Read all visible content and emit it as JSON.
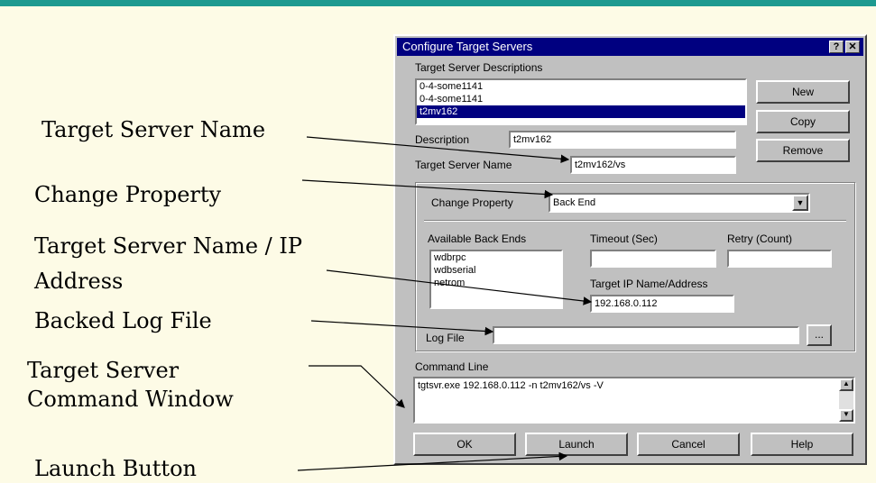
{
  "callouts": {
    "target_server_name": "Target Server Name",
    "change_property": "Change Property",
    "target_ip_line1": "Target Server Name / IP",
    "target_ip_line2": "Address",
    "backed_log_file": "Backed Log File",
    "command_window_line1": "Target Server",
    "command_window_line2": "Command Window",
    "launch_button": "Launch Button"
  },
  "dialog": {
    "title": "Configure Target Servers",
    "help_glyph": "?",
    "close_glyph": "✕",
    "descriptions_label": "Target Server Descriptions",
    "descriptions": [
      "0-4-some1141",
      "0-4-some1141",
      "t2mv162"
    ],
    "selected_index": 2,
    "new_label": "New",
    "copy_label": "Copy",
    "remove_label": "Remove",
    "description_label": "Description",
    "description_value": "t2mv162",
    "target_server_name_label": "Target Server Name",
    "target_server_name_value": "t2mv162/vs",
    "change_property_label": "Change Property",
    "change_property_value": "Back End",
    "available_backends_label": "Available Back Ends",
    "backends": [
      "wdbrpc",
      "wdbserial",
      "netrom"
    ],
    "timeout_label": "Timeout (Sec)",
    "retry_label": "Retry (Count)",
    "target_ip_label": "Target IP Name/Address",
    "target_ip_value": "192.168.0.112",
    "log_file_label": "Log File",
    "log_file_value": "",
    "browse_label": "...",
    "command_line_label": "Command Line",
    "command_line_value": "tgtsvr.exe 192.168.0.112 -n t2mv162/vs -V",
    "ok_label": "OK",
    "launch_label": "Launch",
    "cancel_label": "Cancel",
    "help_label": "Help"
  }
}
